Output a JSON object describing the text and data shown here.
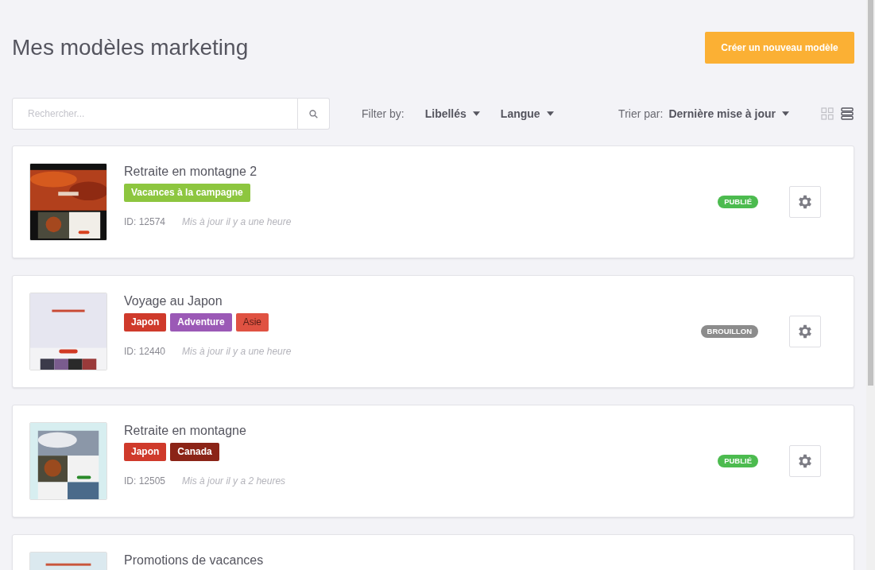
{
  "title": "Mes modèles marketing",
  "create_button": "Créer un nouveau modèle",
  "search": {
    "placeholder": "Rechercher..."
  },
  "filter": {
    "label": "Filter by:",
    "dropdowns": [
      "Libellés",
      "Langue"
    ]
  },
  "sort": {
    "label": "Trier par:",
    "value": "Dernière mise à jour"
  },
  "view_toggle": [
    {
      "kind": "grid",
      "selected": false
    },
    {
      "kind": "list",
      "selected": true
    }
  ],
  "templates": [
    {
      "name": "Retraite en montagne 2",
      "thumbnail": {
        "kind": "picture"
      },
      "tags": [
        {
          "label": "Vacances à la campagne",
          "color": "#8dc63f",
          "dark_label": false
        }
      ],
      "id": "ID: 12574",
      "updated": "Mis à jour il y a une heure",
      "status": {
        "label": "PUBLIÉ",
        "kind": "published"
      }
    },
    {
      "name": "Voyage au Japon",
      "thumbnail": {
        "kind": "picture"
      },
      "tags": [
        {
          "label": "Japon",
          "color": "#cf3a2b",
          "dark_label": false
        },
        {
          "label": "Adventure",
          "color": "#9b59b6",
          "dark_label": false
        },
        {
          "label": "Asie",
          "color": "#e05242",
          "dark_label": true
        }
      ],
      "id": "ID: 12440",
      "updated": "Mis à jour il y a une heure",
      "status": {
        "label": "BROUILLON",
        "kind": "draft"
      }
    },
    {
      "name": "Retraite en montagne",
      "thumbnail": {
        "kind": "picture"
      },
      "tags": [
        {
          "label": "Japon",
          "color": "#cf3a2b",
          "dark_label": false
        },
        {
          "label": "Canada",
          "color": "#8b2417",
          "dark_label": false
        }
      ],
      "id": "ID: 12505",
      "updated": "Mis à jour il y a 2 heures",
      "status": {
        "label": "PUBLIÉ",
        "kind": "published"
      }
    },
    {
      "name": "Promotions de vacances",
      "thumbnail": {
        "kind": "picture"
      }
    }
  ]
}
